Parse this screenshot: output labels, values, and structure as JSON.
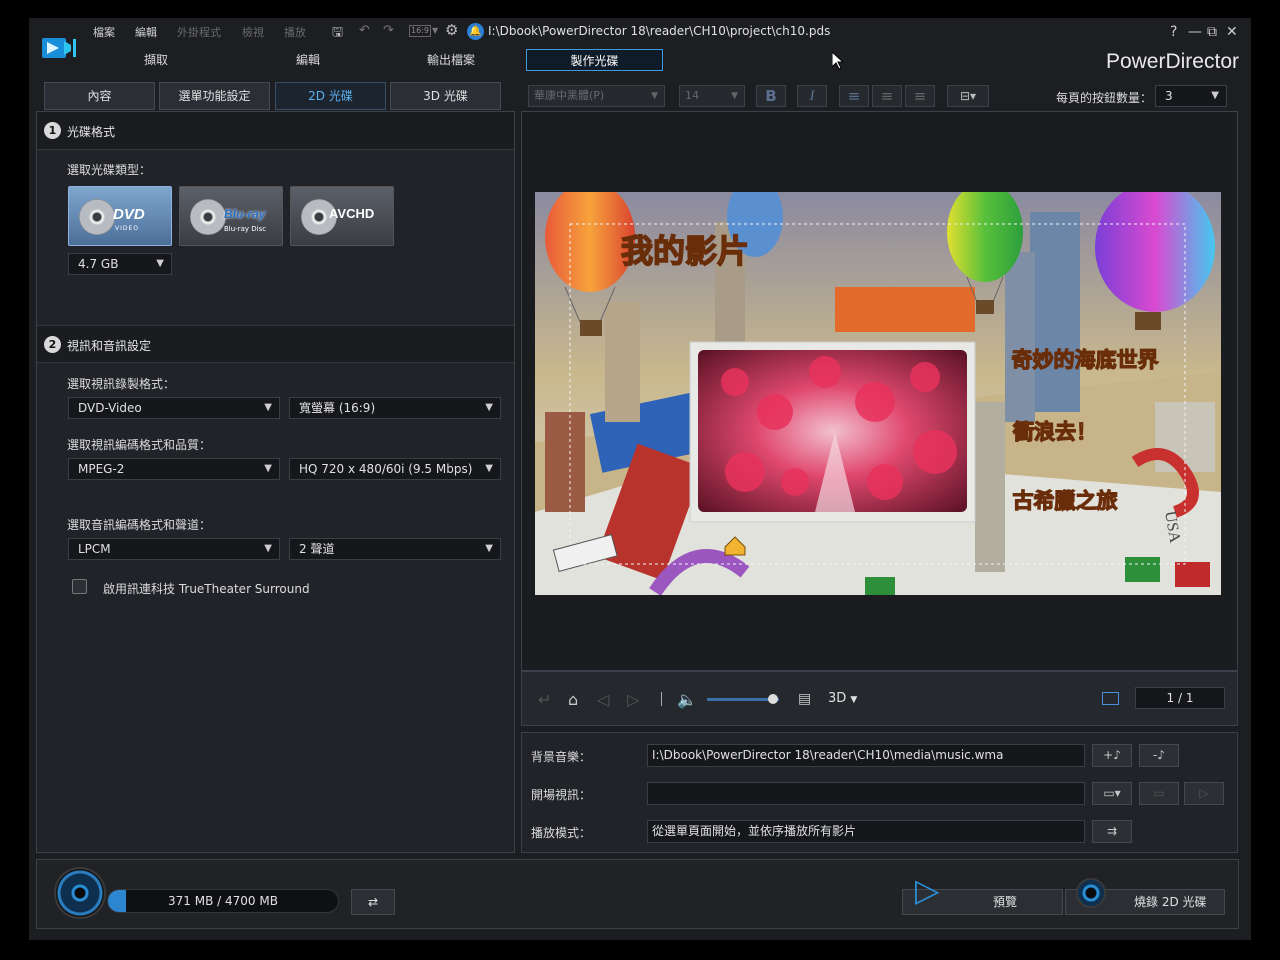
{
  "menu": {
    "file": "檔案",
    "edit": "編輯",
    "plugins": "外掛程式",
    "view": "檢視",
    "play": "播放"
  },
  "toolbar": {
    "aspect": "16:9",
    "project_path": "I:\\Dbook\\PowerDirector 18\\reader\\CH10\\project\\ch10.pds"
  },
  "window": {
    "help": "?",
    "minimize": "—",
    "restore": "⧉",
    "close": "✕"
  },
  "brand": "PowerDirector",
  "main_tabs": [
    "擷取",
    "編輯",
    "輸出檔案",
    "製作光碟"
  ],
  "sub_tabs": [
    "內容",
    "選單功能設定",
    "2D 光碟",
    "3D 光碟"
  ],
  "disc_format": {
    "section_num": "1",
    "section_title": "光碟格式",
    "choose_label": "選取光碟類型：",
    "discs": [
      {
        "logo": "DVD",
        "sub": "VIDEO"
      },
      {
        "logo": "Blu-ray",
        "sub": "Blu-ray Disc"
      },
      {
        "logo": "AVCHD",
        "sub": ""
      }
    ],
    "capacity": "4.7 GB"
  },
  "av_settings": {
    "section_num": "2",
    "section_title": "視訊和音訊設定",
    "video_format_label": "選取視訊錄製格式：",
    "video_format": "DVD-Video",
    "aspect_ratio": "寬螢幕 (16:9)",
    "video_codec_label": "選取視訊編碼格式和品質：",
    "video_codec": "MPEG-2",
    "video_quality": "HQ 720 x 480/60i (9.5 Mbps)",
    "audio_codec_label": "選取音訊編碼格式和聲道：",
    "audio_codec": "LPCM",
    "audio_channels": "2 聲道",
    "truetheater_label": "啟用訊連科技 TrueTheater Surround"
  },
  "format_bar": {
    "font": "華康中黑體(P)",
    "size": "14",
    "buttons_per_page_label": "每頁的按鈕數量：",
    "buttons_per_page": "3"
  },
  "menu_preview": {
    "title": "我的影片",
    "items": [
      "奇妙的海底世界",
      "衝浪去！",
      "古希臘之旅"
    ],
    "board_text": "USA"
  },
  "preview_controls": {
    "mode_3d": "3D",
    "page": "1 / 1",
    "volume": 0.85
  },
  "bottom_settings": {
    "bg_music_label": "背景音樂：",
    "bg_music_value": "I:\\Dbook\\PowerDirector 18\\reader\\CH10\\media\\music.wma",
    "intro_video_label": "開場視訊：",
    "intro_video_value": "",
    "play_mode_label": "播放模式：",
    "play_mode_value": "從選單頁面開始，並依序播放所有影片"
  },
  "footer": {
    "capacity_text": "371 MB / 4700 MB",
    "capacity_used_fraction": 0.079,
    "preview_label": "預覽",
    "burn_label": "燒錄 2D 光碟"
  }
}
